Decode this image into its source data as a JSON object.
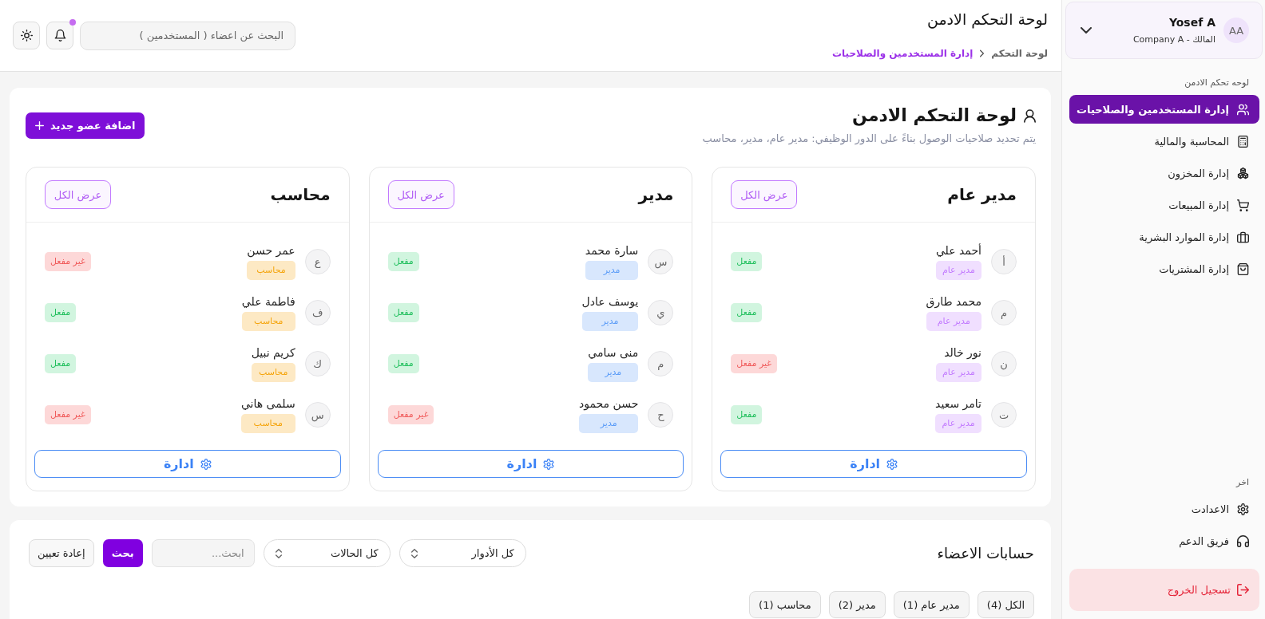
{
  "sidebar": {
    "profile": {
      "initials": "AA",
      "name": "Yosef A",
      "subtitle": "المالك - Company A"
    },
    "sections": [
      {
        "heading": "لوحه تحكم الادمن",
        "items": [
          {
            "label": "إدارة المستخدمين والصلاحيات",
            "selected": true
          },
          {
            "label": "المحاسبة والمالية",
            "selected": false
          },
          {
            "label": "إدارة المخزون",
            "selected": false
          },
          {
            "label": "إدارة المبيعات",
            "selected": false
          },
          {
            "label": "إدارة الموارد البشرية",
            "selected": false
          },
          {
            "label": "إدارة المشتريات",
            "selected": false
          }
        ]
      },
      {
        "heading": "اخر",
        "items": [
          {
            "label": "الاعدادت",
            "selected": false
          },
          {
            "label": "فريق الدعم",
            "selected": false
          }
        ]
      }
    ],
    "logout": "تسجيل الخروج"
  },
  "header": {
    "title": "لوحة التحكم الادمن",
    "breadcrumb": [
      "لوحة التحكم",
      "إدارة المستخدمين والصلاحيات"
    ],
    "search": {
      "placeholder": "البحث عن اعضاء ( المستخدمين )"
    },
    "notifications": {
      "unread": true
    }
  },
  "overview": {
    "title": "لوحة التحكم الادمن",
    "subtitle": "يتم تحديد صلاحيات الوصول بناءً على الدور الوظيفي: مدير عام، مدير، محاسب",
    "add_button": "اضافة عضو جديد",
    "role_groups": [
      {
        "title": "مدير عام",
        "view_all": "عرض الكل",
        "color": "#c27aff",
        "manage_button": "ادارة",
        "members": [
          {
            "initial": "أ",
            "name": "أحمد علي",
            "role": "مدير عام",
            "status": "مفعل",
            "active": true
          },
          {
            "initial": "م",
            "name": "محمد طارق",
            "role": "مدير عام",
            "status": "مفعل",
            "active": true
          },
          {
            "initial": "ن",
            "name": "نور خالد",
            "role": "مدير عام",
            "status": "غير مفعل",
            "active": false
          },
          {
            "initial": "ت",
            "name": "تامر سعيد",
            "role": "مدير عام",
            "status": "مفعل",
            "active": true
          }
        ]
      },
      {
        "title": "مدير",
        "view_all": "عرض الكل",
        "color": "#5b9cf8",
        "manage_button": "ادارة",
        "members": [
          {
            "initial": "س",
            "name": "سارة محمد",
            "role": "مدير",
            "status": "مفعل",
            "active": true
          },
          {
            "initial": "ي",
            "name": "يوسف عادل",
            "role": "مدير",
            "status": "مفعل",
            "active": true
          },
          {
            "initial": "م",
            "name": "منى سامي",
            "role": "مدير",
            "status": "مفعل",
            "active": true
          },
          {
            "initial": "ح",
            "name": "حسن محمود",
            "role": "مدير",
            "status": "غير مفعل",
            "active": false
          }
        ]
      },
      {
        "title": "محاسب",
        "view_all": "عرض الكل",
        "color": "#f5a40b",
        "manage_button": "ادارة",
        "members": [
          {
            "initial": "ع",
            "name": "عمر حسن",
            "role": "محاسب",
            "status": "غير مفعل",
            "active": false
          },
          {
            "initial": "ف",
            "name": "فاطمة علي",
            "role": "محاسب",
            "status": "مفعل",
            "active": true
          },
          {
            "initial": "ك",
            "name": "كريم نبيل",
            "role": "محاسب",
            "status": "مفعل",
            "active": true
          },
          {
            "initial": "س",
            "name": "سلمى هاني",
            "role": "محاسب",
            "status": "غير مفعل",
            "active": false
          }
        ]
      }
    ]
  },
  "accounts": {
    "title": "حسابات الاعضاء",
    "role_filter": "كل الأدوار",
    "status_filter": "كل الحالات",
    "search": {
      "placeholder": "ابحث..."
    },
    "search_button": "بحث",
    "reset_button": "إعادة تعيين",
    "tabs": [
      "الكل (4)",
      "مدير عام (1)",
      "مدير (2)",
      "محاسب (1)"
    ]
  }
}
